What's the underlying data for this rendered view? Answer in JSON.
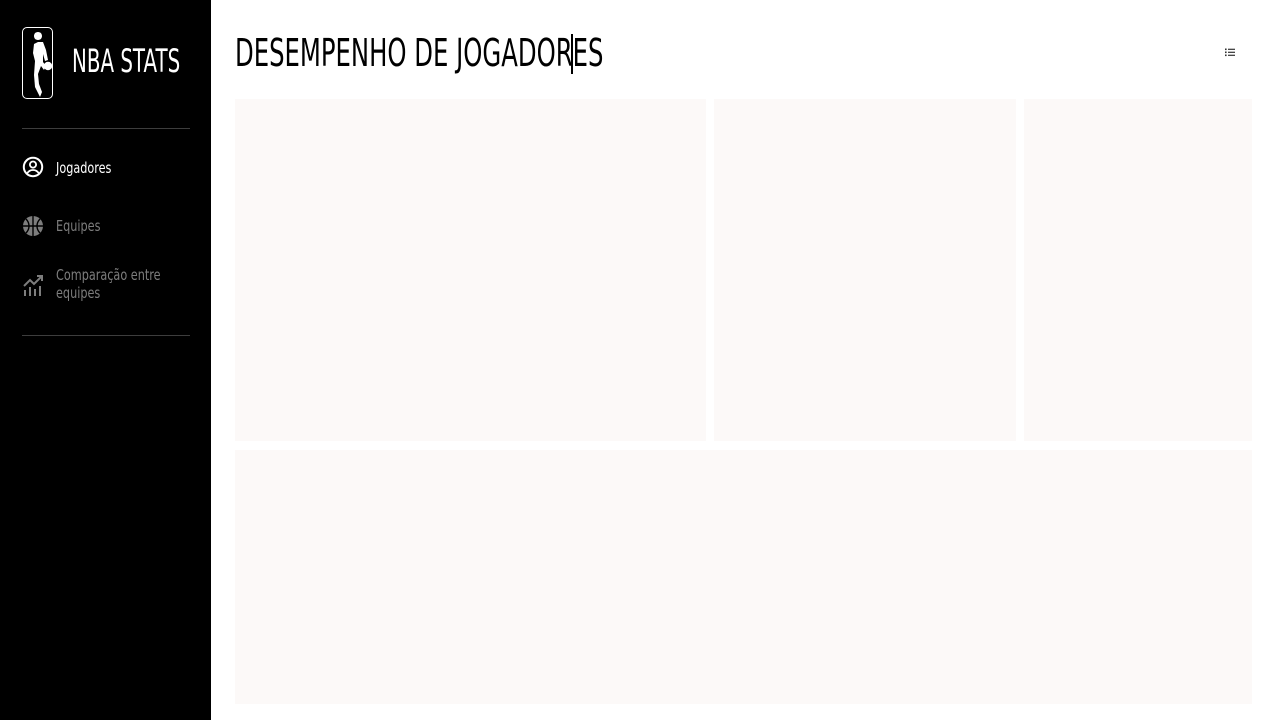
{
  "sidebar": {
    "brand_title": "NBA STATS",
    "items": [
      {
        "label": "Jogadores",
        "icon": "user-circle-icon",
        "active": true
      },
      {
        "label": "Equipes",
        "icon": "basketball-icon",
        "active": false
      },
      {
        "label": "Comparação entre equipes",
        "icon": "trend-chart-icon",
        "active": false
      }
    ]
  },
  "header": {
    "title": "DESEMPENHO DE JOGADORES",
    "menu_icon": "list-icon"
  },
  "colors": {
    "sidebar_bg": "#000000",
    "active_text": "#ffffff",
    "inactive_text": "#7d7d7d",
    "panel_bg": "#fcf9f8"
  }
}
